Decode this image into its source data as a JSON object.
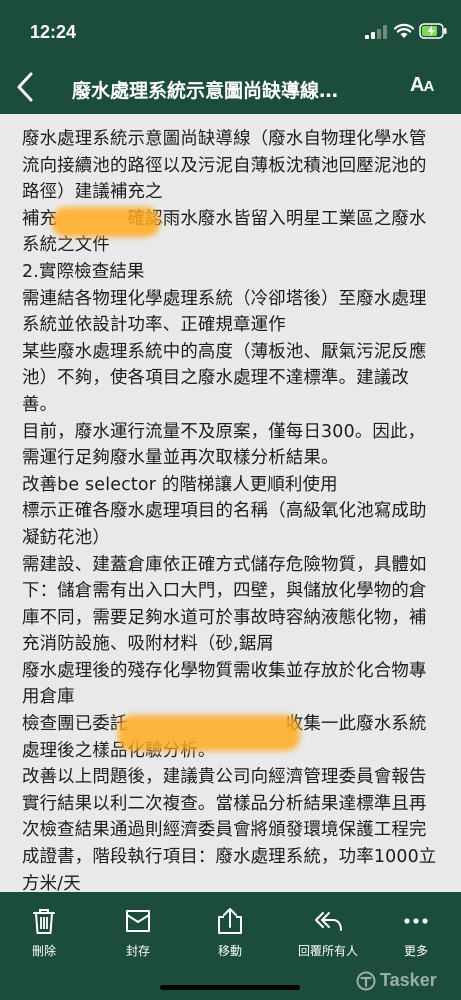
{
  "status_bar": {
    "time": "12:24"
  },
  "nav": {
    "title": "廢水處理系統示意圖尚缺導線…",
    "text_size_big": "A",
    "text_size_small": "A"
  },
  "body": {
    "text": "廢水處理系統示意圖尚缺導線（廢水自物理化學水管流向接續池的路徑以及污泥自薄板沈積池回壓泥池的路徑）建議補充之\n補充　　　　確認雨水廢水皆留入明星工業區之廢水系統之文件\n2.實際檢查結果\n需連結各物理化學處理系統（冷卻塔後）至廢水處理系統並依設計功率、正確規章運作\n某些廢水處理系統中的高度（薄板池、厭氣污泥反應池）不夠，使各項目之廢水處理不達標準。建議改善。\n目前，廢水運行流量不及原案，僅每日300。因此，需運行足夠廢水量並再次取樣分析結果。\n改善be selector 的階梯讓人更順利使用\n標示正確各廢水處理項目的名稱（高級氧化池寫成助凝鈁花池）\n需建設、建蓋倉庫依正確方式儲存危險物質，具體如下：儲倉需有出入口大門，四壁，與儲放化學物的倉庫不同，需要足夠水道可於事故時容納液態化物，補充消防設施、吸附材料（砂,鋸屑\n廢水處理後的殘存化學物質需收集並存放於化合物專用倉庫\n檢查團已委託　　　　　　　　　收集一此廢水系統處理後之樣品化驗分析。\n改善以上問題後，建議貴公司向經濟管理委員會報告實行結果以利二次複查。當樣品分析結果達標準且再次檢查結果通過則經濟委員會將頒發環境保護工程完成證書，階段執行項目：廢水處理系統，功率1000立方米/天"
  },
  "toolbar": {
    "delete_label": "刪除",
    "archive_label": "封存",
    "move_label": "移動",
    "reply_all_label": "回覆所有人",
    "more_label": "更多"
  },
  "watermark": {
    "text": "Tasker"
  },
  "icons": {
    "back": "chevron-left-icon",
    "text_size": "text-size-icon",
    "delete": "trash-icon",
    "archive": "archive-box-icon",
    "move": "move-folder-icon",
    "reply_all": "reply-all-icon",
    "more": "ellipsis-icon"
  },
  "colors": {
    "bar_background": "#1b4d3a",
    "content_background": "#e9e9e9",
    "text": "#1c1c1c",
    "redaction": "#ffaa1e",
    "battery_charge": "#7ed957"
  }
}
